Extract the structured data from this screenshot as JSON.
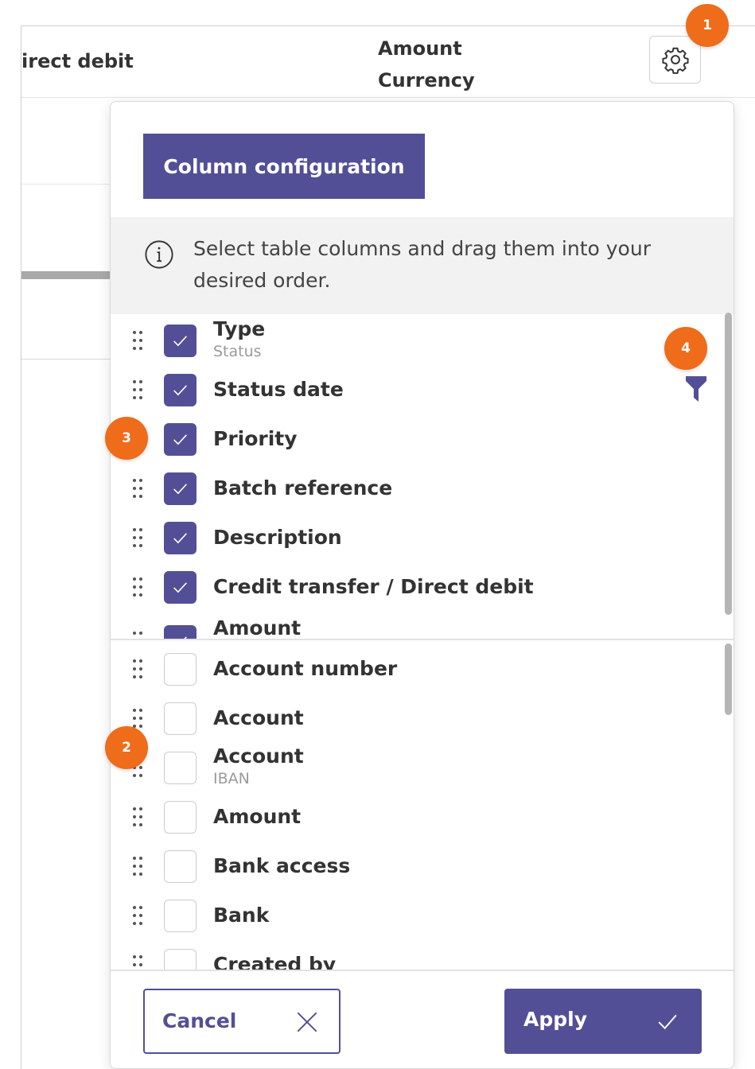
{
  "table": {
    "header_col1": "irect debit",
    "header_col2_line1": "Amount",
    "header_col2_line2": "Currency"
  },
  "badges": {
    "b1": "1",
    "b2": "2",
    "b3": "3",
    "b4": "4"
  },
  "panel": {
    "tab_label": "Column configuration",
    "info_text": "Select table columns and drag them into your desired order.",
    "selected_columns": [
      {
        "label": "Type",
        "sub": "Status",
        "checked": true
      },
      {
        "label": "Status date",
        "checked": true
      },
      {
        "label": "Priority",
        "checked": true
      },
      {
        "label": "Batch reference",
        "checked": true
      },
      {
        "label": "Description",
        "checked": true
      },
      {
        "label": "Credit transfer / Direct debit",
        "checked": true
      },
      {
        "label": "Amount",
        "checked": true
      }
    ],
    "available_columns": [
      {
        "label": "Account number",
        "checked": false
      },
      {
        "label": "Account",
        "checked": false
      },
      {
        "label": "Account",
        "sub": "IBAN",
        "checked": false
      },
      {
        "label": "Amount",
        "checked": false
      },
      {
        "label": "Bank access",
        "checked": false
      },
      {
        "label": "Bank",
        "checked": false
      },
      {
        "label": "Created by",
        "checked": false
      }
    ],
    "cancel_label": "Cancel",
    "apply_label": "Apply"
  },
  "colors": {
    "accent": "#534f96",
    "badge": "#ee6c1a",
    "info_bg": "#f2f2f2"
  },
  "icons": {
    "settings": "gear-icon",
    "info": "info-icon",
    "filter": "filter-icon",
    "cancel": "close-icon",
    "apply": "check-icon",
    "drag": "drag-handle-icon"
  }
}
